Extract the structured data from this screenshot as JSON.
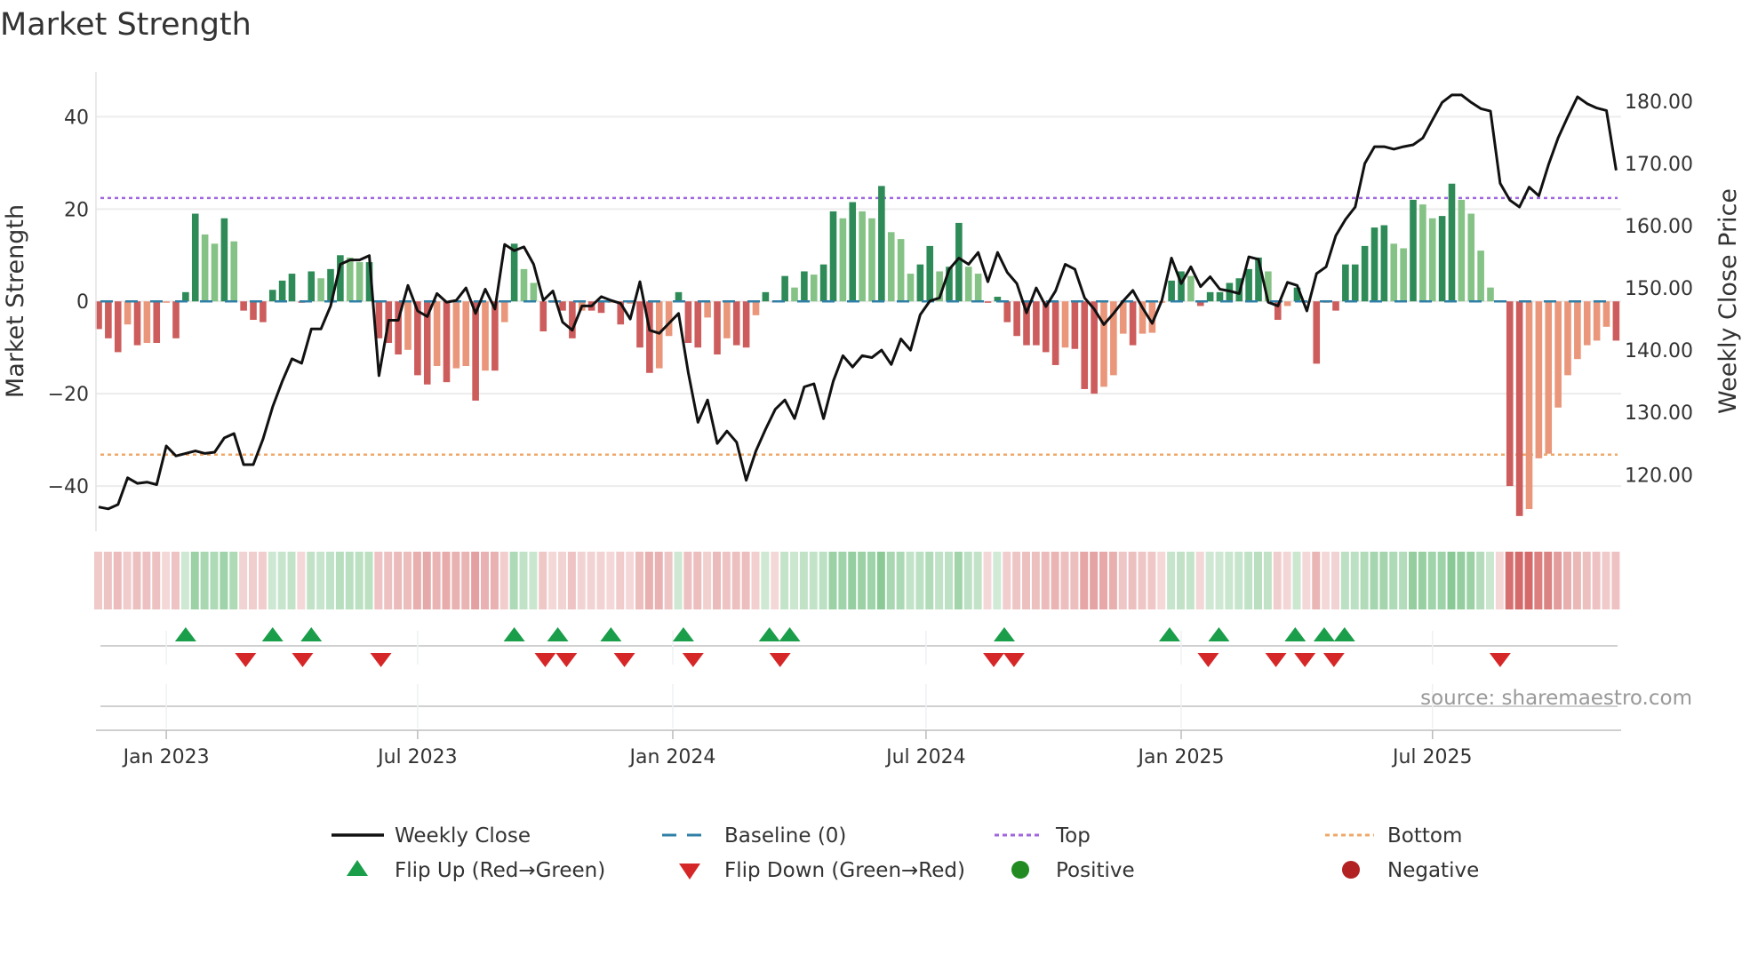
{
  "chart_data": {
    "type": "bar",
    "title": "Market Strength",
    "ylabel": "Market Strength",
    "y2label": "Weekly Close Price",
    "ylim": [
      -49.8,
      49.7
    ],
    "y2lim": [
      110.9,
      184.7
    ],
    "yticks": [
      {
        "v": 40,
        "label": "40"
      },
      {
        "v": 20,
        "label": "20"
      },
      {
        "v": 0,
        "label": "0"
      },
      {
        "v": -20,
        "label": "−20"
      },
      {
        "v": -40,
        "label": "−40"
      }
    ],
    "y2ticks": [
      {
        "v": 180,
        "label": "180.00"
      },
      {
        "v": 170,
        "label": "170.00"
      },
      {
        "v": 160,
        "label": "160.00"
      },
      {
        "v": 150,
        "label": "150.00"
      },
      {
        "v": 140,
        "label": "140.00"
      },
      {
        "v": 130,
        "label": "130.00"
      },
      {
        "v": 120,
        "label": "120.00"
      }
    ],
    "xticks": [
      {
        "week": 7,
        "label": "Jan 2023"
      },
      {
        "week": 33,
        "label": "Jul 2023"
      },
      {
        "week": 59.4,
        "label": "Jan 2024"
      },
      {
        "week": 85.6,
        "label": "Jul 2024"
      },
      {
        "week": 112,
        "label": "Jan 2025"
      },
      {
        "week": 138,
        "label": "Jul 2025"
      }
    ],
    "top_level": 22.4,
    "bottom_level": -33.2,
    "baseline": 0,
    "strength": [
      -6,
      -8,
      -11,
      -5,
      -9.5,
      -9,
      -9,
      -0.3,
      -8,
      2,
      19,
      14.5,
      12.5,
      18,
      13,
      -2,
      -4,
      -4.5,
      2.5,
      4.5,
      6,
      -0.3,
      6.5,
      5,
      7,
      10,
      9.5,
      8.5,
      8.5,
      -8,
      -9,
      -11.5,
      -10.5,
      -16,
      -18,
      -14,
      -17.5,
      -14.5,
      -14,
      -21.5,
      -15,
      -15,
      -4.5,
      12.5,
      7,
      4,
      -6.5,
      -0.3,
      -2,
      -8,
      -2,
      -2,
      -2.5,
      -0.3,
      -5,
      -0.5,
      -10,
      -15.5,
      -14.5,
      -7.5,
      2,
      -9,
      -10,
      -3.5,
      -11.5,
      -8,
      -9.5,
      -10,
      -3,
      2,
      -0.2,
      5.5,
      3,
      6.5,
      5.8,
      8,
      19.5,
      18,
      21.5,
      19.5,
      18,
      25,
      15,
      13.5,
      6,
      8,
      12,
      6.5,
      7.5,
      17,
      7.5,
      6,
      -0.3,
      1,
      -4.5,
      -7.5,
      -9.5,
      -9.5,
      -11,
      -13.8,
      -10,
      -10.3,
      -19,
      -20,
      -18.5,
      -16,
      -7,
      -9.5,
      -7,
      -6.8,
      -0.3,
      4.5,
      6.5,
      5.5,
      -1,
      2,
      2,
      4,
      5,
      7,
      9.5,
      6.5,
      -4,
      -1,
      3,
      -0.3,
      -13.5,
      -0.3,
      -2,
      8,
      8,
      12,
      16,
      16.5,
      12.5,
      11.5,
      22,
      21,
      18,
      18.5,
      25.5,
      22,
      19,
      11,
      3,
      -0.2,
      -40,
      -46.5,
      -45,
      -34,
      -33,
      -23,
      -16,
      -12.5,
      -9.5,
      -8.5,
      -5.5,
      -8.5
    ],
    "weekly_close": [
      114.8,
      114.5,
      115.2,
      119.5,
      118.6,
      118.8,
      118.4,
      124.6,
      123,
      123.4,
      123.8,
      123.4,
      123.6,
      125.9,
      126.6,
      121.6,
      121.6,
      125.7,
      130.9,
      135,
      138.6,
      137.9,
      143.4,
      143.4,
      147.1,
      153.8,
      154.5,
      154.5,
      155.2,
      135.9,
      144.8,
      144.8,
      150.4,
      146.3,
      145.4,
      149.1,
      147.7,
      148,
      150,
      145.9,
      149.8,
      146.6,
      157,
      156,
      156.6,
      153.8,
      148,
      149.5,
      144.5,
      143.2,
      147.1,
      147.1,
      148.6,
      148,
      147.5,
      145,
      151,
      143.2,
      142.7,
      144.3,
      145.9,
      136.4,
      128.4,
      132,
      125,
      127,
      125.2,
      119.1,
      123.8,
      127.3,
      130.5,
      132,
      129,
      134.1,
      134.6,
      129,
      135,
      139.1,
      137.3,
      139.1,
      138.8,
      140,
      137.7,
      141.8,
      140,
      145.7,
      147.9,
      148.4,
      153,
      154.8,
      153.8,
      155.7,
      151,
      155.7,
      152.5,
      150.7,
      146,
      150,
      147,
      149.5,
      153.8,
      153,
      148.4,
      146.6,
      144.1,
      145.9,
      147.9,
      149.6,
      146.8,
      144.3,
      148,
      154.8,
      150.7,
      153.4,
      150.2,
      151.8,
      149.8,
      149.5,
      149.1,
      155,
      154.6,
      147.7,
      147.1,
      150.9,
      150.4,
      146.3,
      152.3,
      153.4,
      158.4,
      161,
      163,
      170,
      172.7,
      172.7,
      172.3,
      172.7,
      173,
      174.1,
      177,
      179.8,
      181,
      181,
      179.8,
      178.8,
      178.4,
      166.8,
      164.1,
      163,
      166.2,
      164.8,
      169.8,
      174.1,
      177.5,
      180.7,
      179.6,
      178.9,
      178.5,
      168.9
    ],
    "flip_up_weeks": [
      9,
      18,
      22,
      43,
      47.5,
      53,
      60.5,
      69.4,
      71.5,
      93.7,
      110.8,
      115.9,
      123.8,
      126.8,
      128.9
    ],
    "flip_down_weeks": [
      15.2,
      21.1,
      29.2,
      46.2,
      48.4,
      54.4,
      61.5,
      70.5,
      92.6,
      94.7,
      114.8,
      121.8,
      124.8,
      127.8,
      145
    ],
    "colors": {
      "pos_rising": "#2e8b57",
      "pos_falling": "#85c285",
      "neg_falling": "#cd5c5c",
      "neg_rising": "#e9967a",
      "close_line": "#111111",
      "baseline": "#2f7fa6",
      "top": "#a066e0",
      "bottom": "#f0a868",
      "flip_up": "#1a9e4a",
      "flip_down": "#d62728",
      "positive": "#228b22",
      "negative": "#b22222"
    },
    "legend": {
      "weekly_close": "Weekly Close",
      "baseline": "Baseline (0)",
      "top": "Top",
      "bottom": "Bottom",
      "flip_up": "Flip Up (Red→Green)",
      "flip_down": "Flip Down (Green→Red)",
      "positive": "Positive",
      "negative": "Negative"
    },
    "source": "source: sharemaestro.com"
  }
}
